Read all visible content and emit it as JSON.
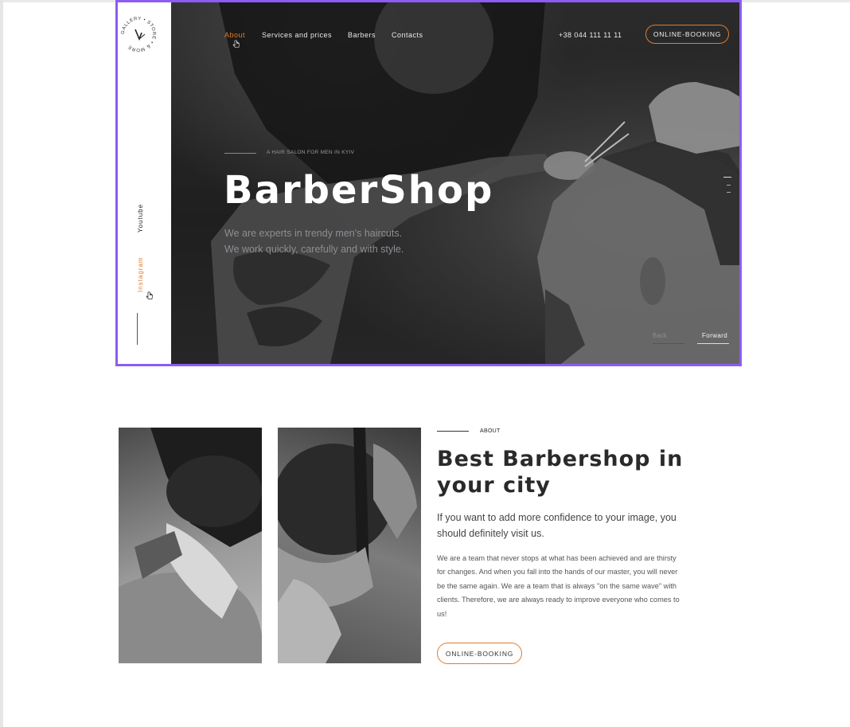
{
  "brand": {
    "logo_text": "GALLERY • STORE • & MORE"
  },
  "nav": {
    "items": [
      {
        "label": "About",
        "active": true
      },
      {
        "label": "Services and prices",
        "active": false
      },
      {
        "label": "Barbers",
        "active": false
      },
      {
        "label": "Contacts",
        "active": false
      }
    ],
    "phone": "+38 044 111 11 11",
    "booking_label": "ONLINE-BOOKING"
  },
  "social": {
    "youtube": "Youtube",
    "instagram": "Instagram"
  },
  "hero": {
    "tagline": "A HAIR SALON FOR MEN IN KYIV",
    "title": "BarberShop",
    "subtitle_line1": "We are experts in trendy men's haircuts.",
    "subtitle_line2": "We work quickly, carefully and with style.",
    "back_label": "Back",
    "forward_label": "Forward"
  },
  "about": {
    "eyebrow": "ABOUT",
    "heading": "Best Barbershop in your city",
    "lead": "If you want to add more confidence to your image, you should definitely visit us.",
    "body": "We are a team that never stops at what has been achieved and are thirsty for changes. And when you fall into the hands of our master, you will never be the same again. We are a team that is always \"on the same wave\" with clients. Therefore, we are always ready to improve everyone who comes to us!",
    "booking_label": "ONLINE-BOOKING"
  },
  "colors": {
    "accent": "#e07b2c",
    "selection_frame": "#8b5cf6",
    "hero_overlay": "#2b2b2b"
  }
}
